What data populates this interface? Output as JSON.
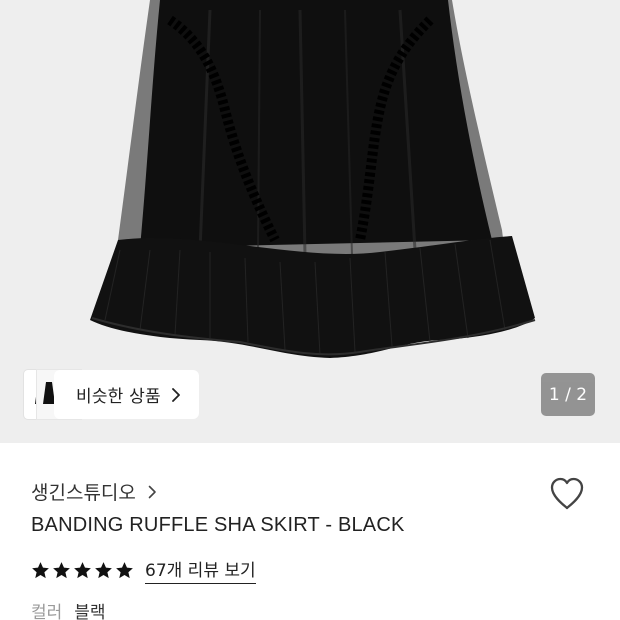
{
  "gallery": {
    "similar_products_label": "비슷한 상품",
    "image_counter": "1 / 2"
  },
  "product": {
    "brand": "생긴스튜디오",
    "title": "BANDING RUFFLE SHA SKIRT - BLACK",
    "rating": {
      "stars": 5,
      "review_link": "67개 리뷰 보기"
    },
    "option": {
      "label": "컬러",
      "value": "블랙"
    }
  },
  "icons": {
    "similar_chevron": "chevron-right-icon",
    "brand_chevron": "chevron-right-icon",
    "wishlist": "heart-outline-icon",
    "star": "star-filled-icon"
  },
  "colors": {
    "hero_background": "#eeeeee",
    "skirt": "#111111",
    "counter_badge": "#8c8c8c"
  }
}
